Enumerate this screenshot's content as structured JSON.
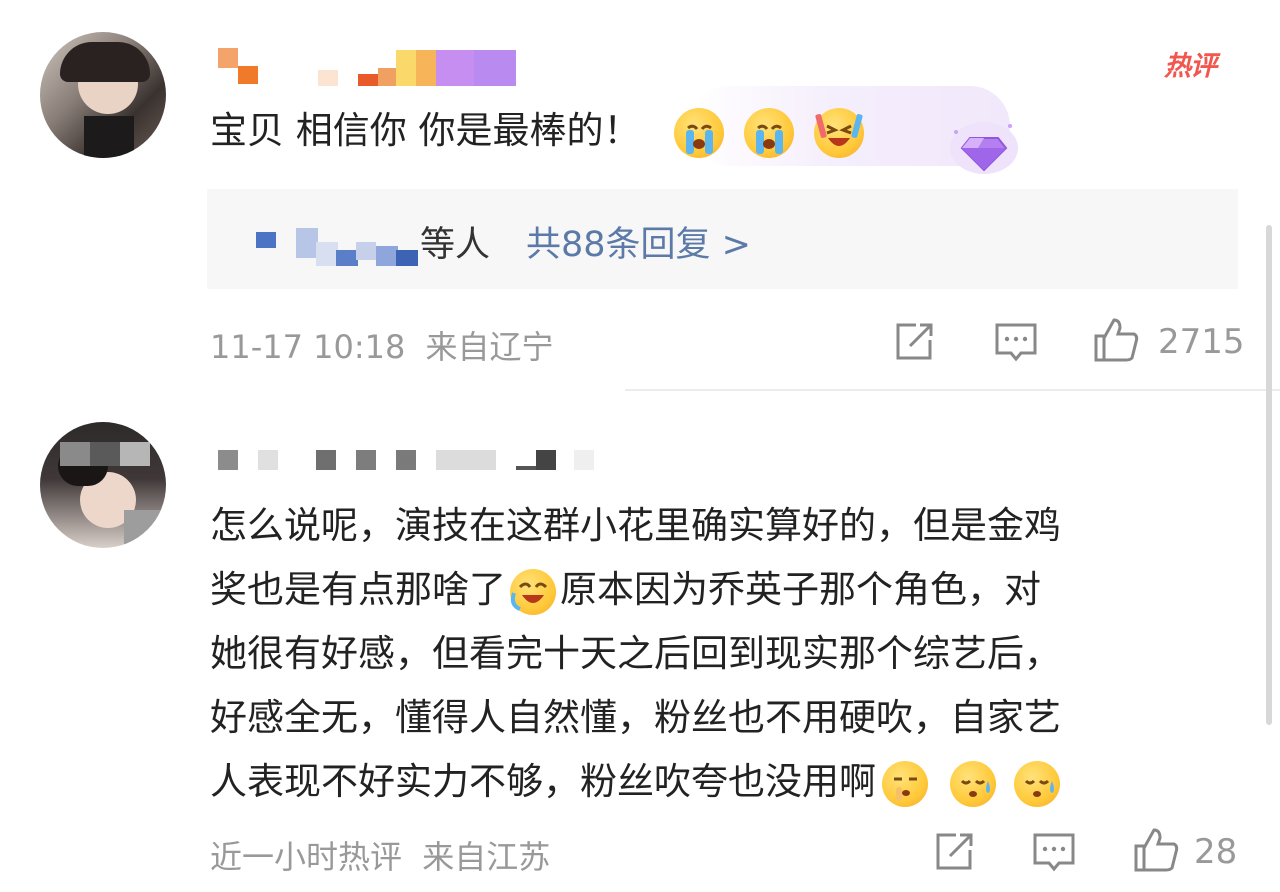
{
  "badge": {
    "label": "热评",
    "color": "#f2574f"
  },
  "comments": [
    {
      "text": "宝贝 相信你 你是最棒的！",
      "emojis": [
        "crying-face-emoji",
        "crying-face-emoji",
        "grinning-cheer-emoji"
      ],
      "reply_summary": {
        "suffix": "等人",
        "link": "共88条回复 >"
      },
      "time": "11-17 10:18",
      "location": "来自辽宁",
      "likes": "2715"
    },
    {
      "line1": "怎么说呢，演技在这群小花里确实算好的，但是金鸡",
      "line2a": "奖也是有点那啥了",
      "line2b": "原本因为乔英子那个角色，对",
      "line3": "她很有好感，但看完十天之后回到现实那个综艺后，",
      "line4": "好感全无，懂得人自然懂，粉丝也不用硬吹，自家艺",
      "line5": "人表现不好实力不够，粉丝吹夸也没用啊",
      "time": "近一小时热评",
      "location": "来自江苏",
      "likes": "28"
    }
  ],
  "colors": {
    "link": "#5b7aa8",
    "meta": "#999999",
    "reply_bg": "#f7f7f7"
  }
}
